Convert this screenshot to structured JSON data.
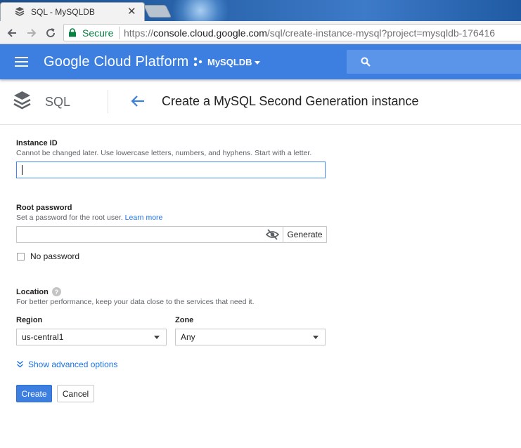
{
  "browser": {
    "tab_title": "SQL - MySQLDB",
    "secure_label": "Secure",
    "url_scheme": "https://",
    "url_host": "console.cloud.google.com",
    "url_path": "/sql/create-instance-mysql?project=mysqldb-176416"
  },
  "header": {
    "brand": "Google Cloud Platform",
    "project": "MySQLDB"
  },
  "titlebar": {
    "section": "SQL",
    "title": "Create a MySQL Second Generation instance"
  },
  "form": {
    "instance_id": {
      "label": "Instance ID",
      "help": "Cannot be changed later. Use lowercase letters, numbers, and hyphens. Start with a letter.",
      "value": ""
    },
    "root_password": {
      "label": "Root password",
      "help": "Set a password for the root user.",
      "learn_more": "Learn more",
      "value": "",
      "generate_label": "Generate"
    },
    "no_password": {
      "label": "No password",
      "checked": false
    },
    "location": {
      "label": "Location",
      "help": "For better performance, keep your data close to the services that need it.",
      "region_label": "Region",
      "region_value": "us-central1",
      "zone_label": "Zone",
      "zone_value": "Any"
    },
    "advanced_label": "Show advanced options",
    "create_label": "Create",
    "cancel_label": "Cancel"
  },
  "colors": {
    "header_blue": "#3c7fe0",
    "link_blue": "#1a73e8",
    "secure_green": "#0b8043"
  }
}
